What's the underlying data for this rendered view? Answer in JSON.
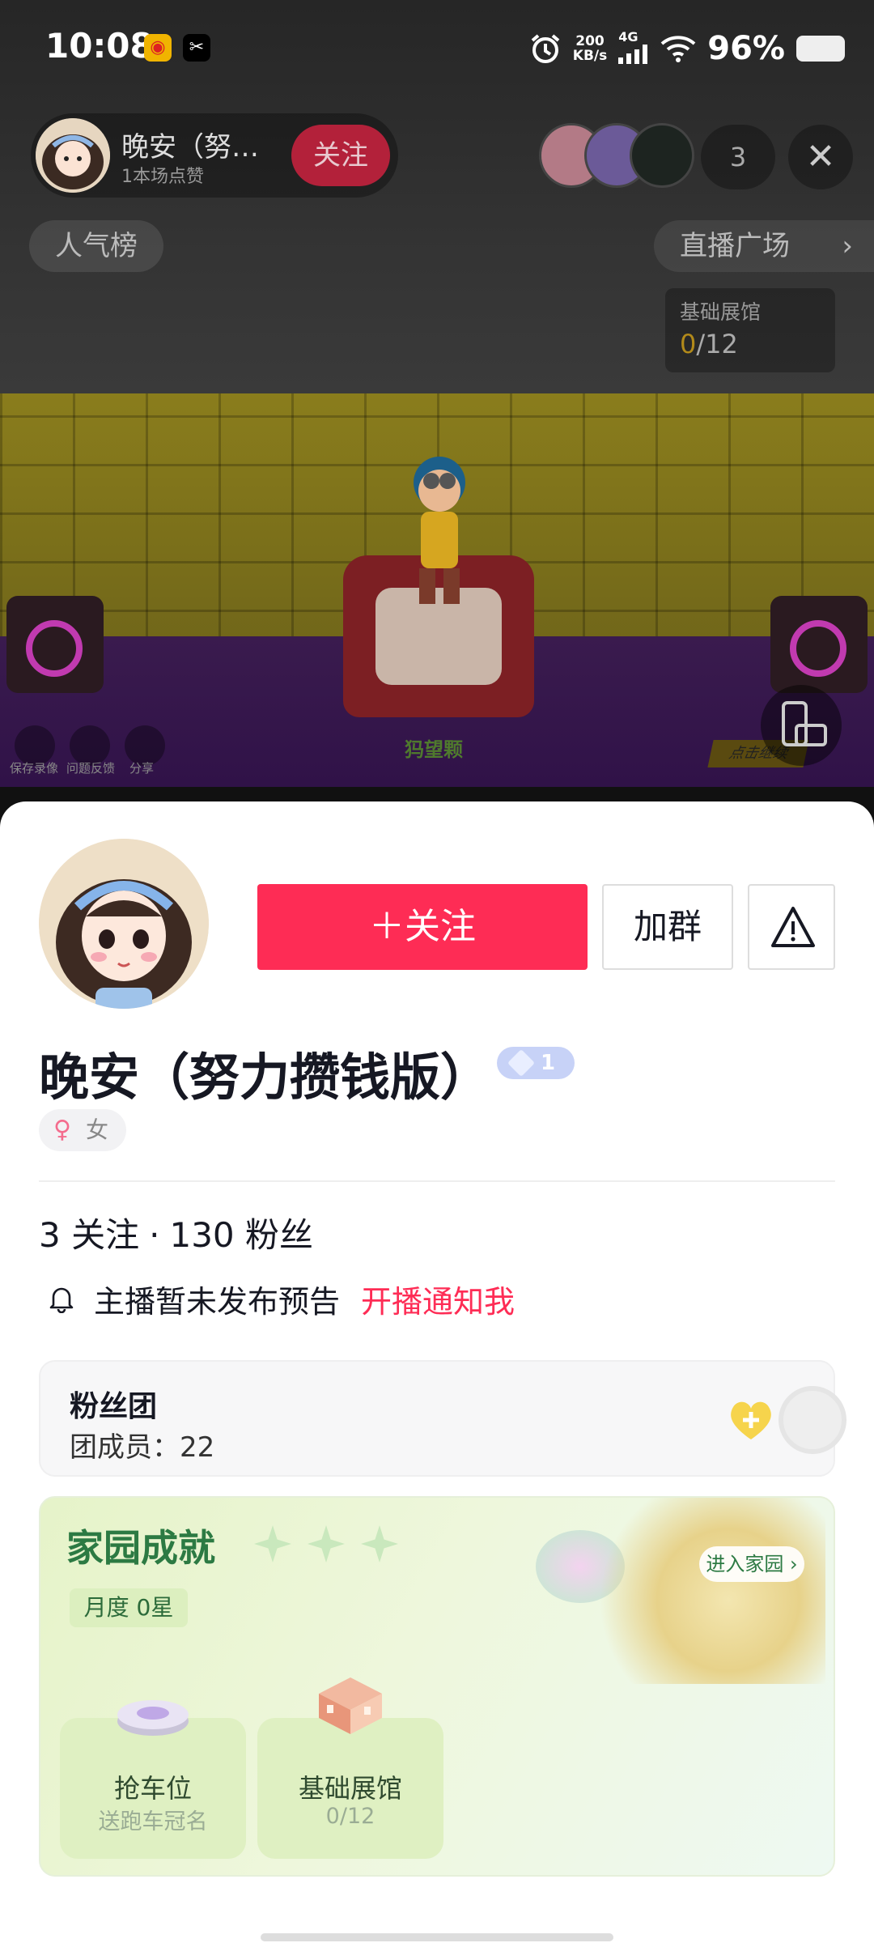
{
  "status_bar": {
    "time": "10:08",
    "speed_value": "200",
    "speed_unit": "KB/s",
    "network": "4G",
    "battery": "96%",
    "icons": [
      "weibo-icon",
      "capcut-icon",
      "alarm-icon",
      "signal-icon",
      "wifi-icon",
      "battery-icon"
    ]
  },
  "live_header": {
    "host_name": "晚安（努…",
    "host_likes": "1本场点赞",
    "follow_label": "关注",
    "viewer_count": "3",
    "rank_label": "人气榜",
    "plaza_label": "直播广场",
    "expo_title": "基础展馆",
    "expo_current": "0",
    "expo_total": "/12"
  },
  "scene": {
    "tool_labels": [
      "保存录像",
      "问题反馈",
      "分享"
    ],
    "brand_text": "犸望颗",
    "continue_label": "点击继续"
  },
  "profile": {
    "follow_label": "关注",
    "group_label": "加群",
    "nickname": "晚安（努力攒钱版）",
    "level": "1",
    "gender": "女",
    "following_count": "3",
    "following_label": "关注",
    "separator": "·",
    "fans_count": "130",
    "fans_label": "粉丝",
    "notice_text": "主播暂未发布预告",
    "notice_link": "开播通知我"
  },
  "fan_club": {
    "title": "粉丝团",
    "members": "团成员：22"
  },
  "home": {
    "title": "家园成就",
    "monthly": "月度 0星",
    "enter_label": "进入家园",
    "tiles": [
      {
        "title": "抢车位",
        "subtitle": "送跑车冠名"
      },
      {
        "title": "基础展馆",
        "subtitle": "0/12"
      }
    ]
  },
  "colors": {
    "accent": "#fe2c55",
    "home_green": "#2c7a43"
  }
}
